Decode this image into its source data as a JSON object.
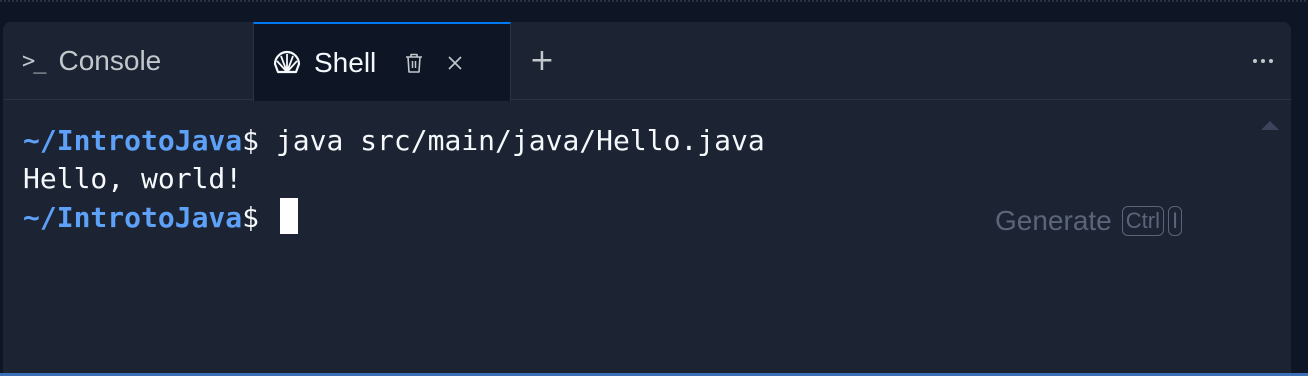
{
  "tabs": {
    "console": {
      "label": "Console",
      "icon": "terminal-prompt-icon"
    },
    "shell": {
      "label": "Shell",
      "icon": "shell-icon",
      "active": true
    },
    "add_label": "+",
    "more_icon": "more-horizontal-icon"
  },
  "terminal": {
    "lines": [
      {
        "cwd": "~/IntrotoJava",
        "prompt": "$ ",
        "command": "java src/main/java/Hello.java"
      },
      {
        "output": "Hello, world!"
      },
      {
        "cwd": "~/IntrotoJava",
        "prompt": "$ ",
        "command": ""
      }
    ]
  },
  "generate_hint": {
    "label": "Generate",
    "keys": [
      "Ctrl",
      "I"
    ]
  },
  "colors": {
    "background": "#0e1525",
    "panel": "#1c2333",
    "active_tab_border": "#0079f2",
    "cwd": "#5ea1f8",
    "text": "#f5f9fc",
    "muted": "#5b6478"
  }
}
